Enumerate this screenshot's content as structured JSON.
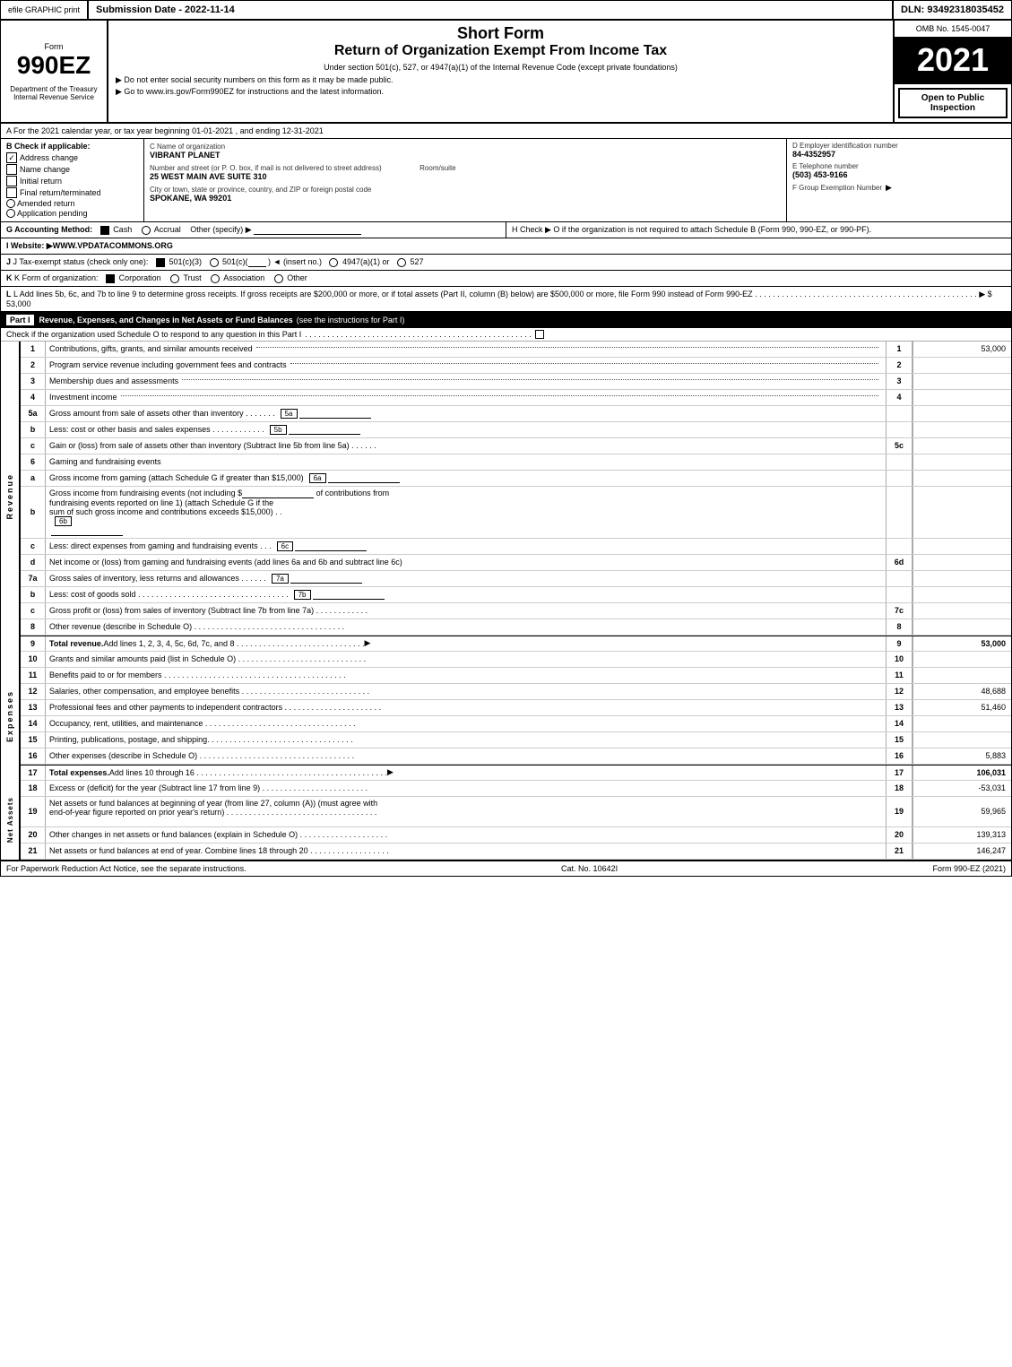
{
  "topHeader": {
    "efile": "efile GRAPHIC print",
    "submission": "Submission Date - 2022-11-14",
    "dln": "DLN: 93492318035452"
  },
  "formHeader": {
    "omb": "OMB No. 1545-0047",
    "formNumber": "990EZ",
    "formLabel": "Form",
    "shortForm": "Short Form",
    "returnTitle": "Return of Organization Exempt From Income Tax",
    "underSection": "Under section 501(c), 527, or 4947(a)(1) of the Internal Revenue Code (except private foundations)",
    "note1": "▶ Do not enter social security numbers on this form as it may be made public.",
    "note2": "▶ Go to www.irs.gov/Form990EZ for instructions and the latest information.",
    "year": "2021",
    "openToPublic": "Open to Public Inspection",
    "dept1": "Department of the Treasury",
    "dept2": "Internal Revenue Service"
  },
  "sectionA": {
    "text": "A  For the 2021 calendar year, or tax year beginning 01-01-2021 , and ending 12-31-2021"
  },
  "sectionB": {
    "label": "B  Check if applicable:",
    "addressChange": "Address change",
    "addressChecked": true,
    "nameChange": "Name change",
    "nameChecked": false,
    "initialReturn": "Initial return",
    "initialChecked": false,
    "finalReturn": "Final return/terminated",
    "finalChecked": false,
    "amendedReturn": "Amended return",
    "amendedChecked": false,
    "applicationPending": "Application pending",
    "applicationChecked": false
  },
  "sectionC": {
    "nameLabel": "C Name of organization",
    "orgName": "VIBRANT PLANET",
    "addressLabel": "Number and street (or P. O. box, if mail is not delivered to street address)",
    "address": "25 WEST MAIN AVE SUITE 310",
    "roomLabel": "Room/suite",
    "roomValue": "",
    "cityLabel": "City or town, state or province, country, and ZIP or foreign postal code",
    "cityValue": "SPOKANE, WA 99201"
  },
  "sectionD": {
    "label": "D Employer identification number",
    "ein": "84-4352957",
    "telLabel": "E Telephone number",
    "tel": "(503) 453-9166",
    "groupLabel": "F Group Exemption Number",
    "groupValue": ""
  },
  "sectionG": {
    "text": "G Accounting Method:",
    "cashChecked": true,
    "cash": "Cash",
    "accrual": "Accrual",
    "accrualChecked": false,
    "other": "Other (specify) ▶",
    "underline": ""
  },
  "sectionH": {
    "text": "H  Check ▶  O if the organization is not required to attach Schedule B (Form 990, 990-EZ, or 990-PF)."
  },
  "sectionI": {
    "text": "I Website: ▶WWW.VPDATACOMMONS.ORG"
  },
  "sectionJ": {
    "text": "J Tax-exempt status (check only one):",
    "501c3": "501(c)(3)",
    "501c3Checked": true,
    "501c": "501(c)(",
    "501cVal": " ) ◄ (insert no.)",
    "4947": "4947(a)(1) or",
    "527": "527"
  },
  "sectionK": {
    "text": "K Form of organization:",
    "corporation": "Corporation",
    "corpChecked": true,
    "trust": "Trust",
    "trustChecked": false,
    "association": "Association",
    "assocChecked": false,
    "other": "Other"
  },
  "sectionL": {
    "text": "L Add lines 5b, 6c, and 7b to line 9 to determine gross receipts. If gross receipts are $200,000 or more, or if total assets (Part II, column (B) below) are $500,000 or more, file Form 990 instead of Form 990-EZ",
    "dots": ". . . . . . . . . . . . . . . . . . . . . . . . . . . . . . . . . . . . . . . . . . . . . . . . . .",
    "arrow": "▶ $",
    "value": "53,000"
  },
  "partI": {
    "label": "Part I",
    "title": "Revenue, Expenses, and Changes in Net Assets or Fund Balances",
    "subtitle": "(see the instructions for Part I)",
    "checkNote": "Check if the organization used Schedule O to respond to any question in this Part I",
    "dots": ". . . . . . . . . . . . . . . . . . . . . . . . . . . . . . . . . . . . . . . . . . . . . . . . . . ."
  },
  "revenueRows": [
    {
      "num": "1",
      "desc": "Contributions, gifts, grants, and similar amounts received",
      "dots": ". . . . . . . . . . . . . . . . . . . . . . . . . . . . . . .",
      "lineNum": "1",
      "value": "53,000"
    },
    {
      "num": "2",
      "desc": "Program service revenue including government fees and contracts",
      "dots": ". . . . . . . . . . . . . . . . . . . . . . .",
      "lineNum": "2",
      "value": ""
    },
    {
      "num": "3",
      "desc": "Membership dues and assessments",
      "dots": ". . . . . . . . . . . . . . . . . . . . . . . . . . . . . . . . . . . . . . . . . . . . . . . . . .",
      "lineNum": "3",
      "value": ""
    },
    {
      "num": "4",
      "desc": "Investment income",
      "dots": ". . . . . . . . . . . . . . . . . . . . . . . . . . . . . . . . . . . . . . . . . . . . . . . . . . . . . . . . . . . . . . . . . . . . . .",
      "lineNum": "4",
      "value": ""
    },
    {
      "num": "5a",
      "desc": "Gross amount from sale of assets other than inventory . . . . . . .",
      "subBox": "5a",
      "lineNum": "",
      "value": ""
    },
    {
      "num": "b",
      "desc": "Less: cost or other basis and sales expenses . . . . . . . . . . . .",
      "subBox": "5b",
      "lineNum": "",
      "value": ""
    },
    {
      "num": "c",
      "desc": "Gain or (loss) from sale of assets other than inventory (Subtract line 5b from line 5a) . . . . . .",
      "lineNum": "5c",
      "value": ""
    },
    {
      "num": "6",
      "desc": "Gaming and fundraising events",
      "lineNum": "",
      "value": ""
    },
    {
      "num": "a",
      "desc": "Gross income from gaming (attach Schedule G if greater than $15,000)",
      "subBox": "6a",
      "lineNum": "",
      "value": ""
    },
    {
      "num": "b",
      "desc": "Gross income from fundraising events (not including $_______________of contributions from fundraising events reported on line 1) (attach Schedule G if the sum of such gross income and contributions exceeds $15,000) . .",
      "subBox": "6b",
      "lineNum": "",
      "value": ""
    },
    {
      "num": "c",
      "desc": "Less: direct expenses from gaming and fundraising events . . .",
      "subBox": "6c",
      "lineNum": "",
      "value": ""
    },
    {
      "num": "d",
      "desc": "Net income or (loss) from gaming and fundraising events (add lines 6a and 6b and subtract line 6c)",
      "lineNum": "6d",
      "value": ""
    },
    {
      "num": "7a",
      "desc": "Gross sales of inventory, less returns and allowances . . . . . .",
      "subBox": "7a",
      "lineNum": "",
      "value": ""
    },
    {
      "num": "b",
      "desc": "Less: cost of goods sold . . . . . . . . . . . . . . . . . . . . . . . . . . . . . . . . . .",
      "subBox": "7b",
      "lineNum": "",
      "value": ""
    },
    {
      "num": "c",
      "desc": "Gross profit or (loss) from sales of inventory (Subtract line 7b from line 7a) . . . . . . . . . . . .",
      "lineNum": "7c",
      "value": ""
    },
    {
      "num": "8",
      "desc": "Other revenue (describe in Schedule O) . . . . . . . . . . . . . . . . . . . . . . . . . . . . . . . . . .",
      "lineNum": "8",
      "value": ""
    },
    {
      "num": "9",
      "desc": "Total revenue. Add lines 1, 2, 3, 4, 5c, 6d, 7c, and 8 . . . . . . . . . . . . . . . . . . . . . . . . . . . . .",
      "arrow": "▶",
      "lineNum": "9",
      "value": "53,000",
      "bold": true
    }
  ],
  "expenseRows": [
    {
      "num": "10",
      "desc": "Grants and similar amounts paid (list in Schedule O) . . . . . . . . . . . . . . . . . . . . . . . . . . . . .",
      "lineNum": "10",
      "value": ""
    },
    {
      "num": "11",
      "desc": "Benefits paid to or for members . . . . . . . . . . . . . . . . . . . . . . . . . . . . . . . . . . . . . . . . .",
      "lineNum": "11",
      "value": ""
    },
    {
      "num": "12",
      "desc": "Salaries, other compensation, and employee benefits . . . . . . . . . . . . . . . . . . . . . . . . . . . . .",
      "lineNum": "12",
      "value": "48,688"
    },
    {
      "num": "13",
      "desc": "Professional fees and other payments to independent contractors . . . . . . . . . . . . . . . . . . . . . .",
      "lineNum": "13",
      "value": "51,460"
    },
    {
      "num": "14",
      "desc": "Occupancy, rent, utilities, and maintenance . . . . . . . . . . . . . . . . . . . . . . . . . . . . . . . . . .",
      "lineNum": "14",
      "value": ""
    },
    {
      "num": "15",
      "desc": "Printing, publications, postage, and shipping . . . . . . . . . . . . . . . . . . . . . . . . . . . . . . . . .",
      "lineNum": "15",
      "value": ""
    },
    {
      "num": "16",
      "desc": "Other expenses (describe in Schedule O) . . . . . . . . . . . . . . . . . . . . . . . . . . . . . . . . . . .",
      "lineNum": "16",
      "value": "5,883"
    },
    {
      "num": "17",
      "desc": "Total expenses. Add lines 10 through 16",
      "dots": ". . . . . . . . . . . . . . . . . . . . . . . . . . . . . . . . . . . . . . . . . . .",
      "arrow": "▶",
      "lineNum": "17",
      "value": "106,031",
      "bold": true
    }
  ],
  "netAssetsRows": [
    {
      "num": "18",
      "desc": "Excess or (deficit) for the year (Subtract line 17 from line 9) . . . . . . . . . . . . . . . . . . . . . . . .",
      "lineNum": "18",
      "value": "-53,031"
    },
    {
      "num": "19",
      "desc": "Net assets or fund balances at beginning of year (from line 27, column (A)) (must agree with end-of-year figure reported on prior year's return) . . . . . . . . . . . . . . . . . . . . . . . . . . . . . . . . . .",
      "lineNum": "19",
      "value": "59,965"
    },
    {
      "num": "20",
      "desc": "Other changes in net assets or fund balances (explain in Schedule O) . . . . . . . . . . . . . . . . . . . .",
      "lineNum": "20",
      "value": "139,313"
    },
    {
      "num": "21",
      "desc": "Net assets or fund balances at end of year. Combine lines 18 through 20 . . . . . . . . . . . . . . . . . .",
      "lineNum": "21",
      "value": "146,247"
    }
  ],
  "footer": {
    "left": "For Paperwork Reduction Act Notice, see the separate instructions.",
    "catNo": "Cat. No. 10642I",
    "right": "Form 990-EZ (2021)"
  }
}
